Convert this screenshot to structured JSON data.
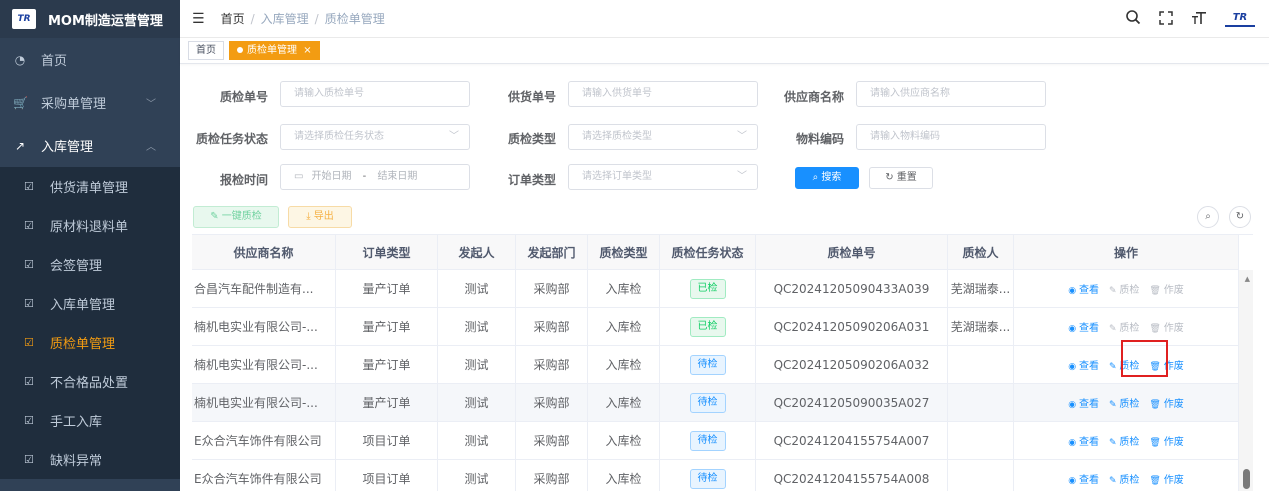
{
  "app": {
    "logo_text": "TR",
    "title": "MOM制造运营管理"
  },
  "sidebar": {
    "items": [
      {
        "icon": "dashboard-icon",
        "glyph": "◔",
        "label": "首页"
      },
      {
        "icon": "cart-icon",
        "glyph": "🛒",
        "label": "采购单管理"
      },
      {
        "icon": "entry-icon",
        "glyph": "↗",
        "label": "入库管理"
      }
    ],
    "sub_items": [
      {
        "label": "供货清单管理"
      },
      {
        "label": "原材料退料单"
      },
      {
        "label": "会签管理"
      },
      {
        "label": "入库单管理"
      },
      {
        "label": "质检单管理"
      },
      {
        "label": "不合格品处置"
      },
      {
        "label": "手工入库"
      },
      {
        "label": "缺料异常"
      }
    ]
  },
  "header": {
    "breadcrumb": [
      "首页",
      "入库管理",
      "质检单管理"
    ],
    "user_logo_text": "TR"
  },
  "tags": {
    "home": "首页",
    "active": "质检单管理"
  },
  "form": {
    "inspection_no": {
      "label": "质检单号",
      "placeholder": "请输入质检单号"
    },
    "supply_no": {
      "label": "供货单号",
      "placeholder": "请输入供货单号"
    },
    "supplier_name": {
      "label": "供应商名称",
      "placeholder": "请输入供应商名称"
    },
    "task_status": {
      "label": "质检任务状态",
      "placeholder": "请选择质检任务状态"
    },
    "inspection_type": {
      "label": "质检类型",
      "placeholder": "请选择质检类型"
    },
    "material_code": {
      "label": "物料编码",
      "placeholder": "请输入物料编码"
    },
    "report_time": {
      "label": "报检时间",
      "start": "开始日期",
      "dash": "-",
      "end": "结束日期"
    },
    "order_type": {
      "label": "订单类型",
      "placeholder": "请选择订单类型"
    },
    "search_label": "搜索",
    "reset_label": "重置"
  },
  "toolbar": {
    "onekey_label": "一键质检",
    "export_label": "导出"
  },
  "table": {
    "columns": [
      "供应商名称",
      "订单类型",
      "发起人",
      "发起部门",
      "质检类型",
      "质检任务状态",
      "质检单号",
      "质检人",
      "操作"
    ],
    "actions": {
      "view": "查看",
      "inspect": "质检",
      "void": "作废"
    },
    "rows": [
      {
        "supplier": "合昌汽车配件制造有...",
        "order_type": "量产订单",
        "initiator": "测试",
        "dept": "采购部",
        "qc_type": "入库检",
        "status": "已检",
        "qc_no": "QC20241205090433A039",
        "inspector": "芜湖瑞泰...",
        "enabled": false
      },
      {
        "supplier": "楠机电实业有限公司-...",
        "order_type": "量产订单",
        "initiator": "测试",
        "dept": "采购部",
        "qc_type": "入库检",
        "status": "已检",
        "qc_no": "QC20241205090206A031",
        "inspector": "芜湖瑞泰...",
        "enabled": false
      },
      {
        "supplier": "楠机电实业有限公司-...",
        "order_type": "量产订单",
        "initiator": "测试",
        "dept": "采购部",
        "qc_type": "入库检",
        "status": "待检",
        "qc_no": "QC20241205090206A032",
        "inspector": "",
        "enabled": true
      },
      {
        "supplier": "楠机电实业有限公司-...",
        "order_type": "量产订单",
        "initiator": "测试",
        "dept": "采购部",
        "qc_type": "入库检",
        "status": "待检",
        "qc_no": "QC20241205090035A027",
        "inspector": "",
        "enabled": true
      },
      {
        "supplier": "E众合汽车饰件有限公司",
        "order_type": "项目订单",
        "initiator": "测试",
        "dept": "采购部",
        "qc_type": "入库检",
        "status": "待检",
        "qc_no": "QC20241204155754A007",
        "inspector": "",
        "enabled": true
      },
      {
        "supplier": "E众合汽车饰件有限公司",
        "order_type": "项目订单",
        "initiator": "测试",
        "dept": "采购部",
        "qc_type": "入库检",
        "status": "待检",
        "qc_no": "QC20241204155754A008",
        "inspector": "",
        "enabled": true
      }
    ]
  }
}
